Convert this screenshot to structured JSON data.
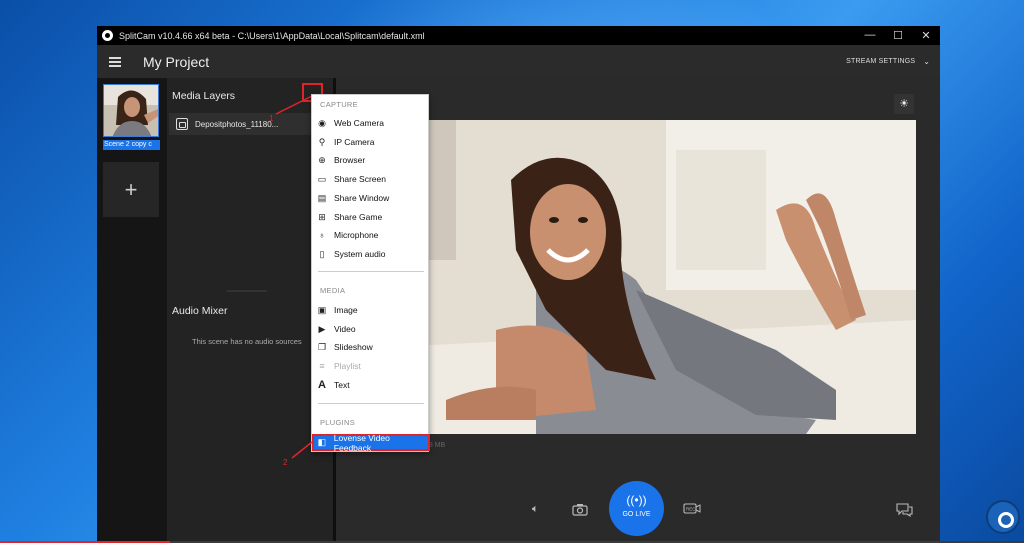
{
  "window": {
    "title": "SplitCam v10.4.66 x64 beta - C:\\Users\\1\\AppData\\Local\\Splitcam\\default.xml",
    "minimize": "—",
    "maximize": "☐",
    "close": "✕"
  },
  "appbar": {
    "project_title": "My Project",
    "stream_settings": "STREAM SETTINGS"
  },
  "scenes": {
    "items": [
      {
        "label": "Scene 2 copy c"
      }
    ],
    "add_label": "+"
  },
  "layers": {
    "heading": "Media Layers",
    "items": [
      {
        "name": "Depositphotos_11180..."
      }
    ]
  },
  "audio_mixer": {
    "heading": "Audio Mixer",
    "empty_text": "This scene has no audio sources"
  },
  "preview": {
    "file_info": "18 MB"
  },
  "controls": {
    "go_live": "GO LIVE"
  },
  "menu": {
    "capture_heading": "CAPTURE",
    "capture_items": [
      {
        "label": "Web Camera",
        "icon": "webcam-icon"
      },
      {
        "label": "IP Camera",
        "icon": "ip-camera-icon"
      },
      {
        "label": "Browser",
        "icon": "globe-icon"
      },
      {
        "label": "Share Screen",
        "icon": "monitor-icon"
      },
      {
        "label": "Share Window",
        "icon": "window-icon"
      },
      {
        "label": "Share Game",
        "icon": "gamepad-icon"
      },
      {
        "label": "Microphone",
        "icon": "microphone-icon"
      },
      {
        "label": "System audio",
        "icon": "speaker-icon"
      }
    ],
    "media_heading": "MEDIA",
    "media_items": [
      {
        "label": "Image",
        "icon": "image-icon"
      },
      {
        "label": "Video",
        "icon": "video-icon"
      },
      {
        "label": "Slideshow",
        "icon": "slideshow-icon"
      },
      {
        "label": "Playlist",
        "icon": "playlist-icon",
        "disabled": true
      },
      {
        "label": "Text",
        "icon": "text-icon"
      }
    ],
    "plugins_heading": "PLUGINS",
    "plugin_items": [
      {
        "label": "Lovense Video Feedback",
        "icon": "plugin-icon"
      }
    ]
  },
  "annotations": {
    "step1": "1",
    "step2": "2"
  },
  "colors": {
    "accent": "#1a73e8",
    "annotation": "#e0242a"
  }
}
